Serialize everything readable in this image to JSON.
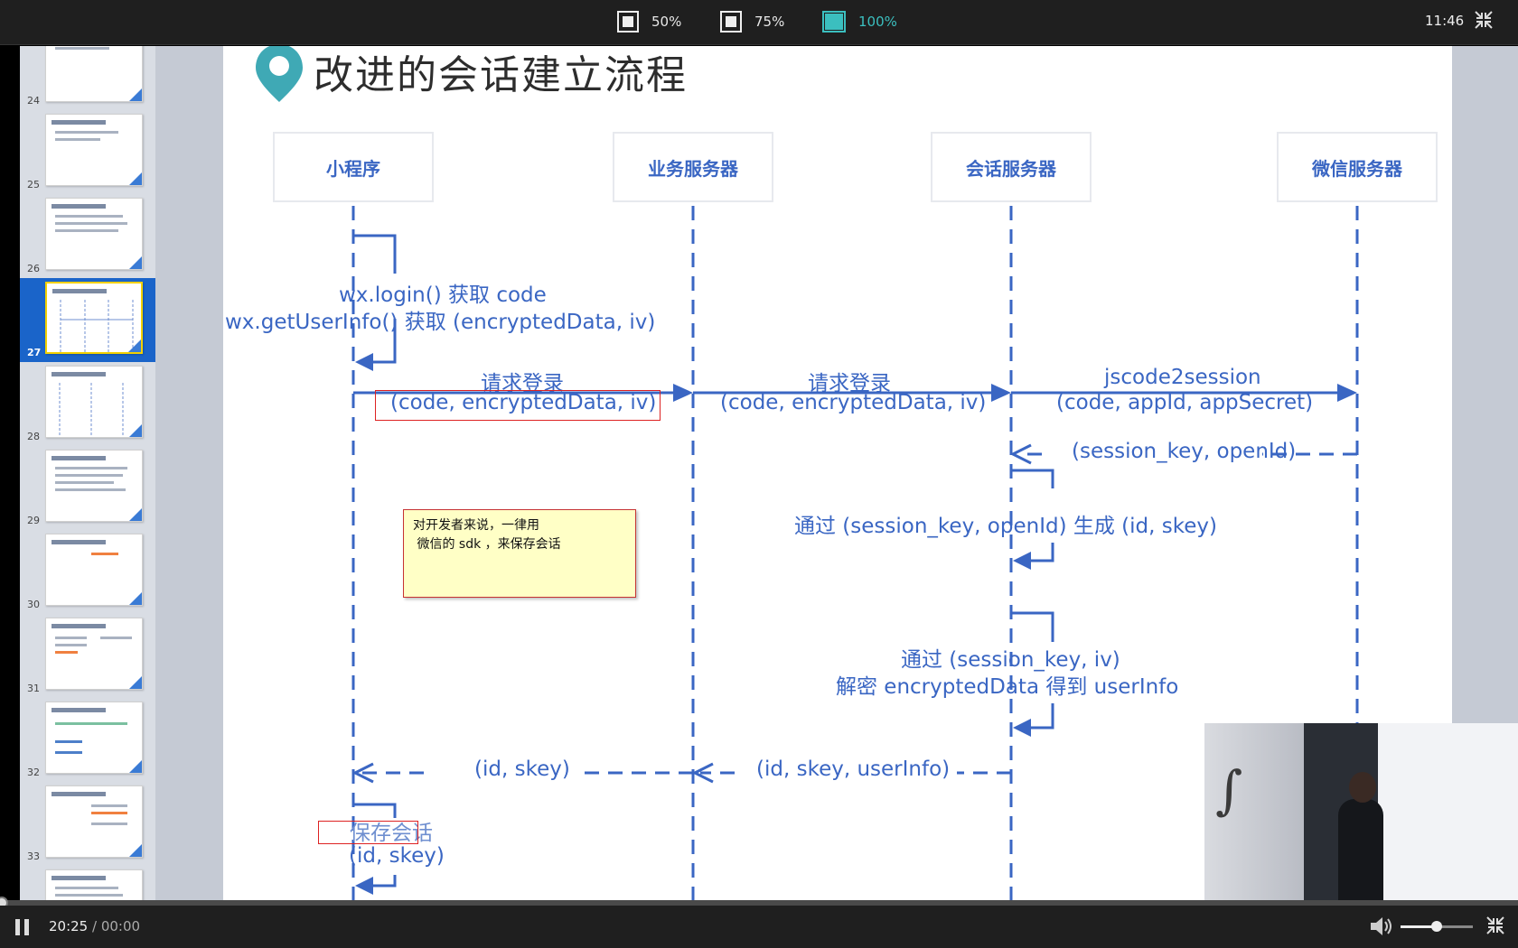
{
  "topbar": {
    "zoom_options": [
      {
        "label": "50%",
        "active": false
      },
      {
        "label": "75%",
        "active": false
      },
      {
        "label": "100%",
        "active": true
      }
    ],
    "clock": "11:46",
    "exit_fullscreen_icon": "collapse-arrows-icon"
  },
  "thumbnails": [
    {
      "number": "24",
      "active": false
    },
    {
      "number": "25",
      "active": false
    },
    {
      "number": "26",
      "active": false
    },
    {
      "number": "27",
      "active": true
    },
    {
      "number": "28",
      "active": false
    },
    {
      "number": "29",
      "active": false
    },
    {
      "number": "30",
      "active": false
    },
    {
      "number": "31",
      "active": false
    },
    {
      "number": "32",
      "active": false
    },
    {
      "number": "33",
      "active": false
    }
  ],
  "slide": {
    "title": "改进的会话建立流程",
    "lanes": [
      "小程序",
      "业务服务器",
      "会话服务器",
      "微信服务器"
    ],
    "messages": {
      "login": "wx.login() 获取 code",
      "getuserinfo": "wx.getUserInfo() 获取 (encryptedData, iv)",
      "req1_label": "请求登录",
      "req1_params": "(code, encryptedData, iv)",
      "req2_label": "请求登录",
      "req2_params": "(code, encryptedData, iv)",
      "jscode_label": "jscode2session",
      "jscode_params": "(code, appId, appSecret)",
      "session_return": "(session_key, openId)",
      "gen_skey": "通过 (session_key, openId) 生成 (id, skey)",
      "decrypt1": "通过 (session_key, iv)",
      "decrypt2": "解密 encryptedData 得到 userInfo",
      "ret1": "(id, skey)",
      "ret2": "(id, skey, userInfo)",
      "save_label": "保存会话",
      "save_params": "(id, skey)"
    },
    "note_lines": [
      "对开发者来说，一律用",
      " 微信的 sdk ，来保存会话"
    ]
  },
  "player": {
    "current_time": "20:25",
    "duration": " / 00:00",
    "progress": 0,
    "volume": 0.5,
    "volume_icon": "speaker-icon",
    "fullscreen_icon": "collapse-arrows-icon"
  }
}
